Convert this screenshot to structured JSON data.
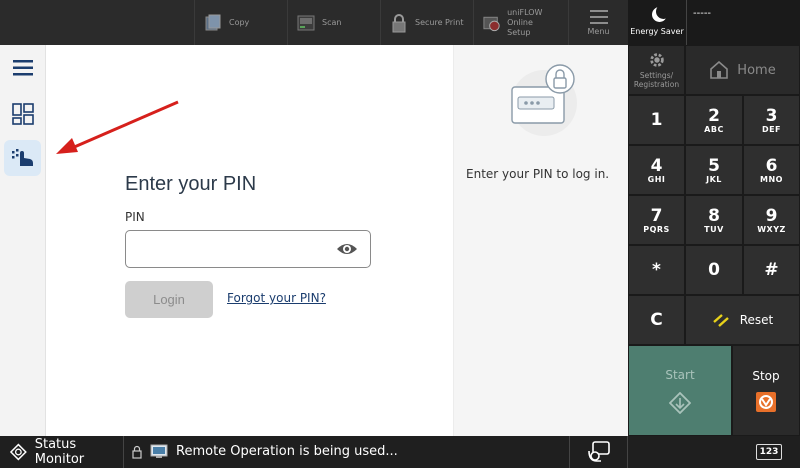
{
  "topbar": {
    "copy": "Copy",
    "scan": "Scan",
    "secure_print": "Secure Print",
    "uniflow_line1": "uniFLOW Online",
    "uniflow_line2": "Setup",
    "menu": "Menu",
    "energy_saver": "Energy Saver",
    "user": "-----"
  },
  "sidebar": {
    "items": [
      {
        "name": "menu",
        "icon": "hamburger-icon"
      },
      {
        "name": "apps",
        "icon": "apps-grid-icon"
      },
      {
        "name": "login",
        "icon": "login-icon",
        "selected": true
      }
    ]
  },
  "login": {
    "title": "Enter your PIN",
    "pin_label": "PIN",
    "pin_value": "",
    "login_button": "Login",
    "forgot_link": "Forgot your PIN?",
    "info_text": "Enter your PIN to log in."
  },
  "keypad": {
    "settings": "Settings/\nRegistration",
    "home": "Home",
    "keys": [
      {
        "digit": "1",
        "sub": ""
      },
      {
        "digit": "2",
        "sub": "ABC"
      },
      {
        "digit": "3",
        "sub": "DEF"
      },
      {
        "digit": "4",
        "sub": "GHI"
      },
      {
        "digit": "5",
        "sub": "JKL"
      },
      {
        "digit": "6",
        "sub": "MNO"
      },
      {
        "digit": "7",
        "sub": "PQRS"
      },
      {
        "digit": "8",
        "sub": "TUV"
      },
      {
        "digit": "9",
        "sub": "WXYZ"
      },
      {
        "digit": "*",
        "sub": ""
      },
      {
        "digit": "0",
        "sub": ""
      },
      {
        "digit": "#",
        "sub": ""
      }
    ],
    "clear": "C",
    "reset": "Reset",
    "start": "Start",
    "stop": "Stop"
  },
  "statusbar": {
    "status_monitor": "Status Monitor",
    "message": "Remote Operation is being used...",
    "keys_badge": "123"
  },
  "colors": {
    "start_green": "#4e7e70",
    "stop_orange": "#e8702a",
    "arrow_red": "#d6201c",
    "reset_yellow": "#e8d21a"
  }
}
